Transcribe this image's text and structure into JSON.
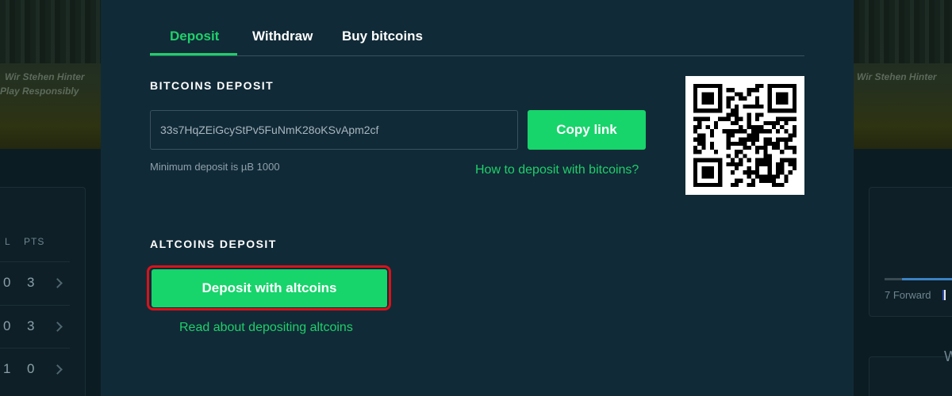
{
  "background": {
    "banner_text_1": "Wir Stehen Hinter",
    "banner_text_2": "Play Responsibly",
    "banner_text_3": "Wir Stehen Hinter",
    "standings": {
      "headers": [
        "L",
        "PTS"
      ],
      "rows": [
        {
          "l": "0",
          "pts": "3"
        },
        {
          "l": "0",
          "pts": "3"
        },
        {
          "l": "1",
          "pts": "0"
        }
      ]
    },
    "player_label": "7 Forward",
    "partial_letter": "W"
  },
  "modal": {
    "tabs": [
      {
        "label": "Deposit",
        "active": true
      },
      {
        "label": "Withdraw",
        "active": false
      },
      {
        "label": "Buy bitcoins",
        "active": false
      }
    ],
    "bitcoin": {
      "title": "BITCOINS DEPOSIT",
      "address": "33s7HqZEiGcyStPv5FuNmK28oKSvApm2cf",
      "copy_label": "Copy link",
      "min_deposit": "Minimum deposit is µB 1000",
      "how_link": "How to deposit with bitcoins?",
      "qr_icon": "qr-code"
    },
    "altcoins": {
      "title": "ALTCOINS DEPOSIT",
      "button_label": "Deposit with altcoins",
      "read_link": "Read about depositing altcoins"
    }
  },
  "colors": {
    "accent": "#1ed06a",
    "button": "#17d46b",
    "modal_bg": "#112a37",
    "highlight": "#d9121b"
  }
}
